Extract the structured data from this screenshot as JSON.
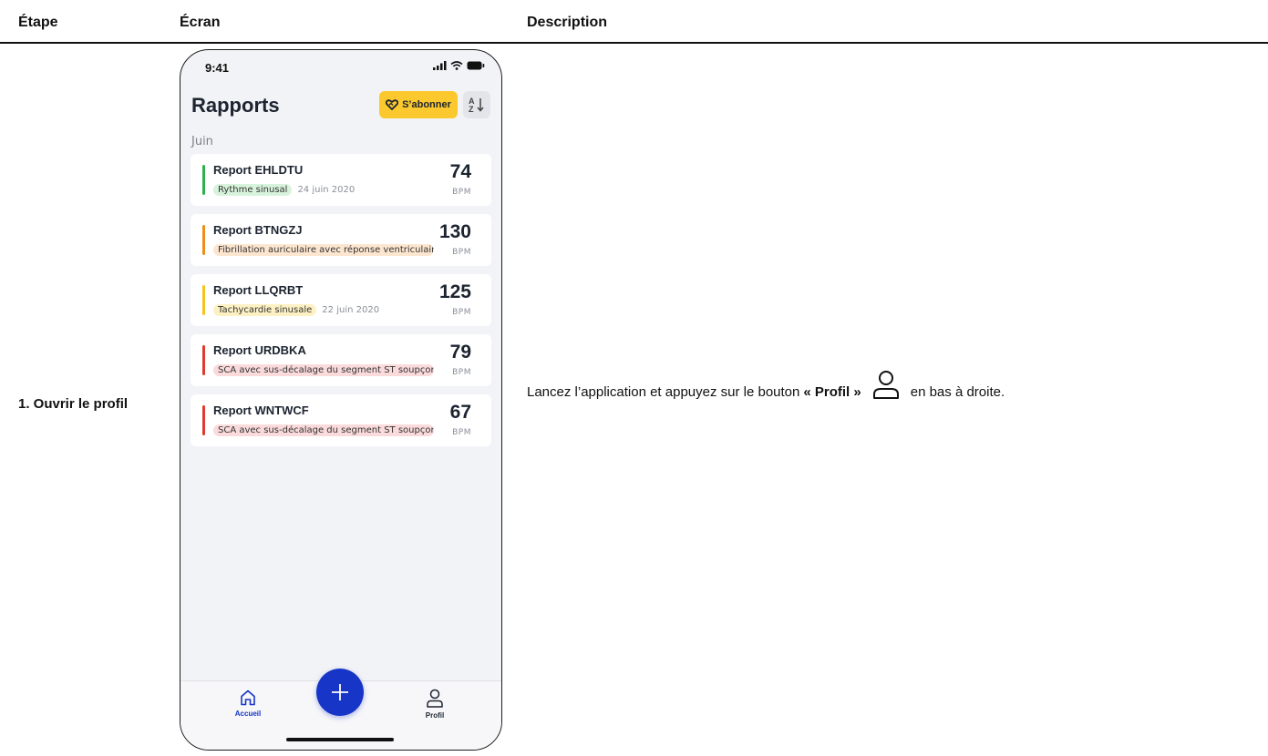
{
  "table": {
    "headers": {
      "step": "Étape",
      "screen": "Écran",
      "description": "Description"
    },
    "row": {
      "step": "1. Ouvrir le profil",
      "description_prefix": "Lancez l’application et appuyez sur le bouton",
      "description_bold": "« Profil »",
      "description_suffix": "en bas à droite.",
      "description_icon": "person-icon"
    }
  },
  "phone": {
    "status_time": "9:41",
    "title": "Rapports",
    "subscribe_label": "S’abonner",
    "subscribe_color": "#fbc82d",
    "sort_icon": "sort-az-icon",
    "month": "Juin",
    "reports": [
      {
        "name": "Report EHLDTU",
        "tag": "Rythme sinusal",
        "date": "24 juin 2020",
        "bpm": "74",
        "unit": "BPM",
        "status_color": "#2fb14a",
        "tag_bg": "#d8f3dc"
      },
      {
        "name": "Report BTNGZJ",
        "tag": "Fibrillation auriculaire avec réponse ventriculair",
        "date": "",
        "bpm": "130",
        "unit": "BPM",
        "status_color": "#f08c1a",
        "tag_bg": "#fde6cf"
      },
      {
        "name": "Report LLQRBT",
        "tag": "Tachycardie sinusale",
        "date": "22 juin 2020",
        "bpm": "125",
        "unit": "BPM",
        "status_color": "#f6c31a",
        "tag_bg": "#fdf1c4"
      },
      {
        "name": "Report URDBKA",
        "tag": "SCA avec sus-décalage du segment ST soupçon",
        "date": "",
        "bpm": "79",
        "unit": "BPM",
        "status_color": "#e03a2f",
        "tag_bg": "#fadadb"
      },
      {
        "name": "Report WNTWCF",
        "tag": "SCA avec sus-décalage du segment ST soupçon",
        "date": "",
        "bpm": "67",
        "unit": "BPM",
        "status_color": "#e03a2f",
        "tag_bg": "#fadadb"
      }
    ],
    "tabs": {
      "home_label": "Accueil",
      "profile_label": "Profil",
      "active_color": "#1735c7"
    },
    "fab_icon": "plus-icon"
  }
}
